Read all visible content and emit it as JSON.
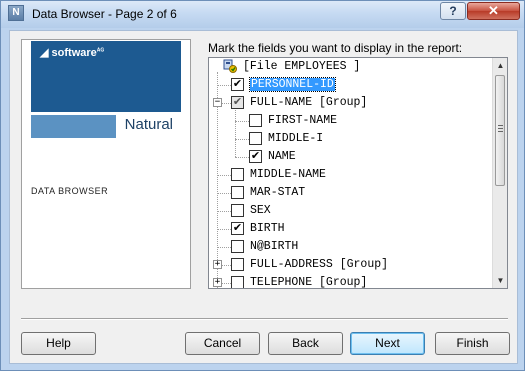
{
  "window": {
    "title": "Data Browser - Page 2 of 6",
    "app_icon_letter": "N",
    "help_glyph": "?",
    "close_glyph": "✕"
  },
  "brand": {
    "company": "software",
    "company_suffix": "AG",
    "product": "Natural",
    "caption": "DATA BROWSER"
  },
  "instructions": "Mark the fields you want to display in the report:",
  "tree": {
    "root_label": "[File EMPLOYEES ]",
    "items": [
      {
        "label": "PERSONNEL-ID",
        "checked": true,
        "level": 1,
        "selected": true
      },
      {
        "label": "FULL-NAME [Group]",
        "checked": true,
        "partial": true,
        "level": 1,
        "expander": "−"
      },
      {
        "label": "FIRST-NAME",
        "checked": false,
        "level": 2
      },
      {
        "label": "MIDDLE-I",
        "checked": false,
        "level": 2
      },
      {
        "label": "NAME",
        "checked": true,
        "level": 2
      },
      {
        "label": "MIDDLE-NAME",
        "checked": false,
        "level": 1
      },
      {
        "label": "MAR-STAT",
        "checked": false,
        "level": 1
      },
      {
        "label": "SEX",
        "checked": false,
        "level": 1
      },
      {
        "label": "BIRTH",
        "checked": true,
        "level": 1
      },
      {
        "label": "N@BIRTH",
        "checked": false,
        "level": 1
      },
      {
        "label": "FULL-ADDRESS [Group]",
        "checked": false,
        "level": 1,
        "expander": "+"
      },
      {
        "label": "TELEPHONE [Group]",
        "checked": false,
        "level": 1,
        "expander": "+"
      }
    ]
  },
  "scrollbar": {
    "up": "▲",
    "down": "▼"
  },
  "buttons": {
    "help": "Help",
    "cancel": "Cancel",
    "back": "Back",
    "next": "Next",
    "finish": "Finish"
  }
}
